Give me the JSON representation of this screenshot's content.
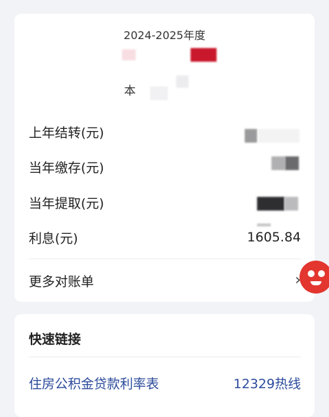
{
  "summary_card": {
    "year_label": "2024-2025年度",
    "balance_label_partial": "本",
    "rows": [
      {
        "label": "上年结转(元)",
        "value": ""
      },
      {
        "label": "当年缴存(元)",
        "value": ""
      },
      {
        "label": "当年提取(元)",
        "value": ""
      },
      {
        "label": "利息(元)",
        "value": "1605.84"
      }
    ],
    "more_statements_label": "更多对账单",
    "chevron_glyph": "›"
  },
  "quick_links": {
    "title": "快速链接",
    "link_label": "住房公积金贷款利率表",
    "hotline_label": "12329热线"
  },
  "colors": {
    "link": "#2c4b9c",
    "mascot": "#e2362f",
    "redacted_red": "#c9182b"
  }
}
